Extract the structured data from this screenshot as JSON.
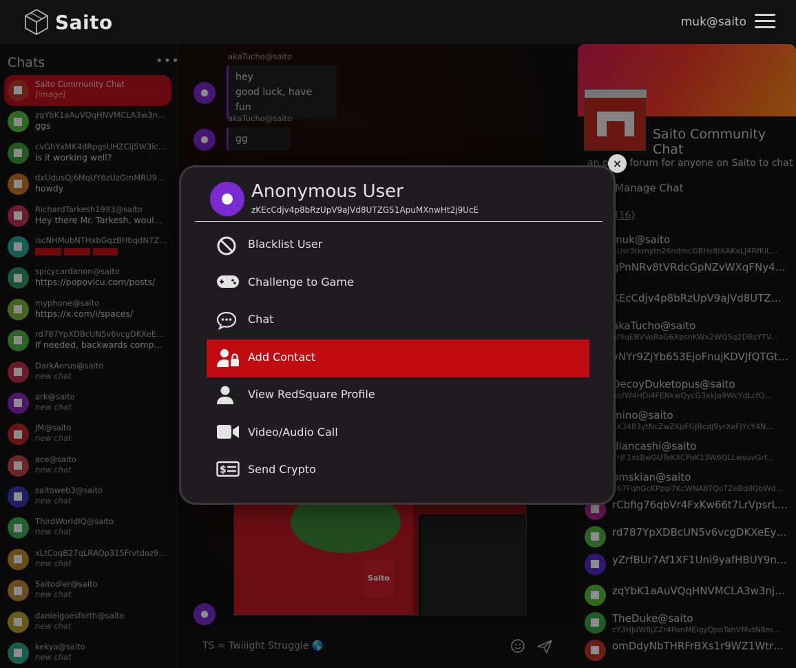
{
  "header": {
    "logo_text": "Saito",
    "user_handle": "muk@saito"
  },
  "sidebar": {
    "title": "Chats",
    "more_label": "•••",
    "chats": [
      {
        "name": "Saito Community Chat",
        "msg": "[image]",
        "italic": true,
        "active": true,
        "color": "#c23a2a"
      },
      {
        "name": "zqYbK1aAuVQqHNVMCLA3w3nj6NA...",
        "msg": "ggs",
        "color": "#5bbf3f"
      },
      {
        "name": "cvGhYxMK4dRpgsUHZCij5W3icGB6...",
        "msg": "is it working well?",
        "color": "#3ea33a"
      },
      {
        "name": "dxUdusQj6MqUY6zUzGmMRU9vjfr7...",
        "msg": "howdy",
        "color": "#c9772b"
      },
      {
        "name": "RichardTarkesh1993@saito",
        "msg": "Hey there Mr. Tarkesh, would you",
        "color": "#c23460"
      },
      {
        "name": "iscNHMubNTHxbGqzBHbqdN7Z1wuV...",
        "msg": "",
        "redbars": true,
        "color": "#2ca8a0"
      },
      {
        "name": "spicycardanon@saito",
        "msg": "https://popovicu.com/posts/",
        "color": "#2f9a6a"
      },
      {
        "name": "myphone@saito",
        "msg": "https://x.com/i/spaces/",
        "color": "#7ab83a"
      },
      {
        "name": "rd787YpXDBcUN5v6vcgDKXeEyJgPf...",
        "msg": "If needed, backwards compatible",
        "color": "#54b54a"
      },
      {
        "name": "DarkAorus@saito",
        "msg": "new chat",
        "italic": true,
        "color": "#c2304a"
      },
      {
        "name": "ark@saito",
        "msg": "new chat",
        "italic": true,
        "color": "#8a2ec0"
      },
      {
        "name": "JM@saito",
        "msg": "new chat",
        "italic": true,
        "color": "#c0262a"
      },
      {
        "name": "ace@saito",
        "msg": "new chat",
        "italic": true,
        "color": "#c24848"
      },
      {
        "name": "saitoweb3@saito",
        "msg": "new chat",
        "italic": true,
        "color": "#3a3ab5"
      },
      {
        "name": "ThirdWorldIQ@saito",
        "msg": "new chat",
        "italic": true,
        "color": "#3fae5a"
      },
      {
        "name": "xLtCoqB27qLRAQp315Frvtdoz9rBJe...",
        "msg": "new chat",
        "italic": true,
        "color": "#c48a2a"
      },
      {
        "name": "Saitodler@saito",
        "msg": "new chat",
        "italic": true,
        "color": "#c48a3a"
      },
      {
        "name": "danielgoesforth@saito",
        "msg": "new chat",
        "italic": true,
        "color": "#b8a42a"
      },
      {
        "name": "kekya@saito",
        "msg": "new chat",
        "italic": true,
        "color": "#2fa88a"
      }
    ]
  },
  "center": {
    "messages": [
      {
        "sender": "akaTucho@saito",
        "lines": [
          "hey",
          "good luck, have fun"
        ]
      },
      {
        "sender": "akaTucho@saito",
        "lines": [
          "gg"
        ]
      }
    ],
    "composer_text": "TS = Twilight Struggle 🌎",
    "image_cup_text": "Saito"
  },
  "right": {
    "title": "Saito Community Chat",
    "description": "an open forum for anyone on Saito to chat",
    "manage_label": "Manage Chat",
    "members_count": "(16)",
    "members": [
      {
        "name": "muk@saito",
        "key": "1Usr3tkmytn26ndmcGBHs8tKAKxLJ4RfKiL...",
        "color": "#c02030"
      },
      {
        "name": "gPnNRv8tVRdcGpNZvWXqFNy4vi...",
        "key": "",
        "color": "#3aa84a"
      },
      {
        "name": "KEcCdjv4p8bRzUpV9aJVd8UTZG...",
        "key": "",
        "color": "#7a2ad0"
      },
      {
        "name": "akaTucho@saito",
        "key": "bf9qEBVVeRaG6XpsnKWx2WQ5q2DBsYTV...",
        "color": "#7a2ad0"
      },
      {
        "name": "yNYr9ZjYb653EjoFnujKDVJfQTGt8...",
        "key": "",
        "color": "#3a8ad0"
      },
      {
        "name": "DecoyDuketopus@saito",
        "key": "nbfW4HDi4FENkwQycG3xkJa9WcYdLcfQ...",
        "color": "#c23a2a"
      },
      {
        "name": "mino@saito",
        "key": "kX3483ytNcZwZKpFGJRcdJ9yrXeFJYcY4N...",
        "color": "#3aa84a"
      },
      {
        "name": "dlancashi@saito",
        "key": "7rJF1xsBwGUTeKXCPoK13W6QLLwsuvGrf...",
        "color": "#c07a2a"
      },
      {
        "name": "omskian@saito",
        "key": "767FqhGcKPzqi7KcWNA8TQoTZeBd8QbWd...",
        "color": "#2aa8a0"
      },
      {
        "name": "rCbfig76qbVr4FxKw66t7LrVpsrLJ...",
        "key": "",
        "color": "#c02a9a"
      },
      {
        "name": "rd787YpXDBcUN5v6vcgDKXeEyJ...",
        "key": "",
        "color": "#54b54a"
      },
      {
        "name": "yZrfBUr7Af1XF1Uni9yafHBUY9nJCs...",
        "key": "",
        "color": "#5a2ad0"
      },
      {
        "name": "zqYbK1aAuVQqHNVMCLA3w3nj6...",
        "key": "",
        "color": "#5bbf3f"
      },
      {
        "name": "TheDuke@saito",
        "key": "cY3HJdW8jZZr4PonMEiqyQpoTahVMvtN8m...",
        "color": "#3aa84a"
      },
      {
        "name": "omDdyNbTHRFrBXs1r9WZ1Wtrx4k...",
        "key": "",
        "color": "#c0362a"
      }
    ]
  },
  "modal": {
    "close_label": "×",
    "user_name": "Anonymous User",
    "user_key": "zKEcCdjv4p8bRzUpV9aJVd8UTZG51ApuMXnwHt2j9UcE",
    "items": [
      {
        "label": "Blacklist User",
        "icon": "ban-icon"
      },
      {
        "label": "Challenge to Game",
        "icon": "gamepad-icon"
      },
      {
        "label": "Chat",
        "icon": "comment-dots-icon"
      },
      {
        "label": "Add Contact",
        "icon": "user-lock-icon",
        "selected": true
      },
      {
        "label": "View RedSquare Profile",
        "icon": "user-icon"
      },
      {
        "label": "Video/Audio Call",
        "icon": "video-icon"
      },
      {
        "label": "Send Crypto",
        "icon": "money-bill-icon"
      }
    ]
  }
}
